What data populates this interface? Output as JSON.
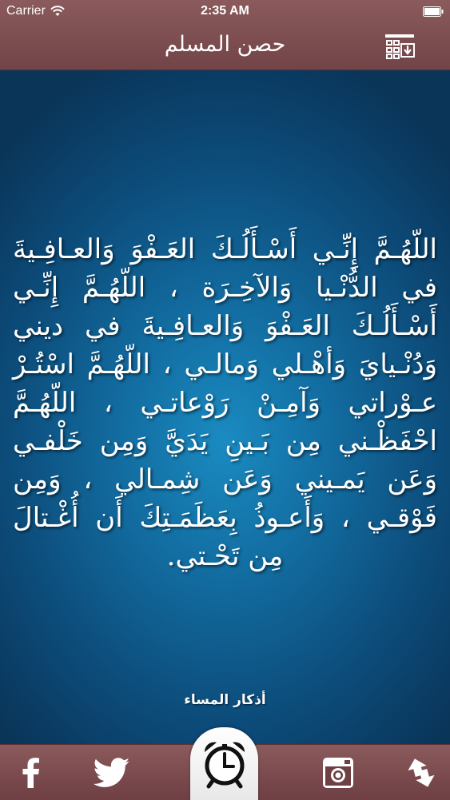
{
  "status_bar": {
    "carrier": "Carrier",
    "time": "2:35 AM"
  },
  "header": {
    "title": "حصن المسلم",
    "menu_icon": "calendar-grid-download-icon"
  },
  "content": {
    "dua_text": "اللّهُـمَّ إِنِّـي أَسْـأَلُـكَ العَـفْوَ وَالعـافِـيةَ في الدُّنْـيا وَالآخِـرَة ، اللّهُـمَّ إِنِّـي أَسْـأَلُـكَ العَـفْوَ وَالعـافِـيةَ في ديني وَدُنْـيايَ وَأهْـلي وَمالـي ، اللّهُـمَّ اسْتُـرْ عـوْراتي وَآمِـنْ رَوْعاتـي ، اللّهُـمَّ احْفَظْـني مِن بَـينِ يَدَيَّ وَمِن خَلْفـي وَعَن يَمـيني وَعَن شِمـالي ، وَمِن فَوْقـي ، وَأَعـوذُ بِعَظَمَـتِكَ أَن أُغْـتالَ مِن تَحْـتي.",
    "section_label": "أذكار المساء"
  },
  "tabbar": {
    "items": [
      {
        "name": "facebook",
        "icon": "facebook-icon"
      },
      {
        "name": "twitter",
        "icon": "twitter-icon"
      },
      {
        "name": "alarm",
        "icon": "alarm-clock-icon"
      },
      {
        "name": "instagram",
        "icon": "instagram-icon"
      },
      {
        "name": "share",
        "icon": "share-arrows-icon"
      }
    ]
  },
  "colors": {
    "bar_background": "#7d4d50",
    "content_center": "#1a8bc1",
    "content_edge": "#0a3559",
    "text": "#ffffff"
  }
}
